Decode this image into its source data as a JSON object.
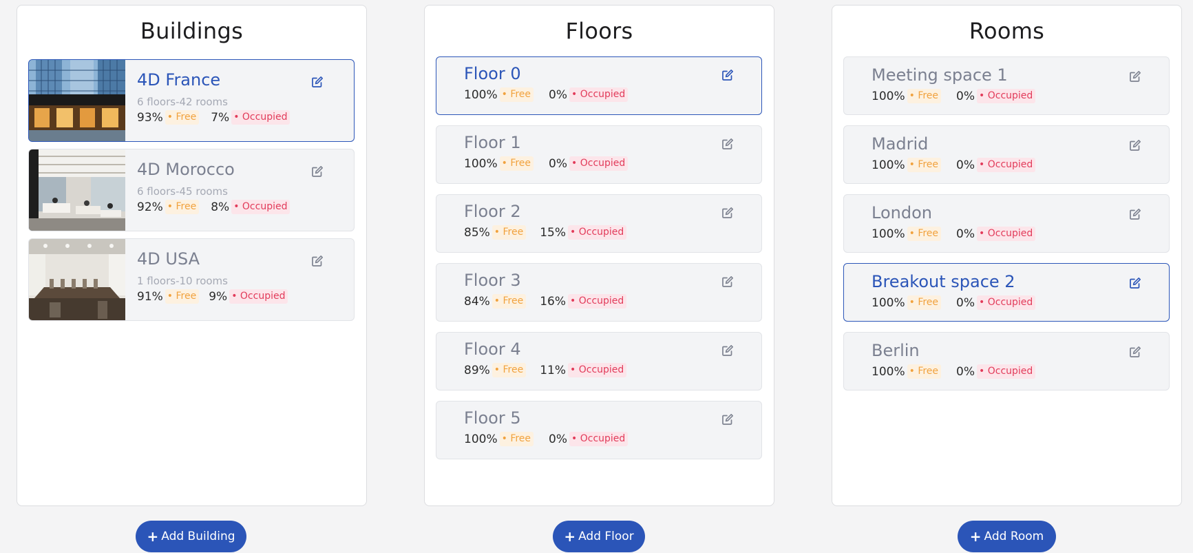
{
  "buildings": {
    "title": "Buildings",
    "items": [
      {
        "name": "4D France",
        "sub": "6 floors-42 rooms",
        "free": "93%",
        "occupied": "7%"
      },
      {
        "name": "4D Morocco",
        "sub": "6 floors-45 rooms",
        "free": "92%",
        "occupied": "8%"
      },
      {
        "name": "4D USA",
        "sub": "1 floors-10 rooms",
        "free": "91%",
        "occupied": "9%"
      }
    ],
    "add_label": "Add Building"
  },
  "floors": {
    "title": "Floors",
    "items": [
      {
        "name": "Floor 0",
        "free": "100%",
        "occupied": "0%"
      },
      {
        "name": "Floor 1",
        "free": "100%",
        "occupied": "0%"
      },
      {
        "name": "Floor 2",
        "free": "85%",
        "occupied": "15%"
      },
      {
        "name": "Floor 3",
        "free": "84%",
        "occupied": "16%"
      },
      {
        "name": "Floor 4",
        "free": "89%",
        "occupied": "11%"
      },
      {
        "name": "Floor 5",
        "free": "100%",
        "occupied": "0%"
      }
    ],
    "add_label": "Add Floor"
  },
  "rooms": {
    "title": "Rooms",
    "items": [
      {
        "name": "Meeting space 1",
        "free": "100%",
        "occupied": "0%"
      },
      {
        "name": "Madrid",
        "free": "100%",
        "occupied": "0%"
      },
      {
        "name": "London",
        "free": "100%",
        "occupied": "0%"
      },
      {
        "name": "Breakout space 2",
        "free": "100%",
        "occupied": "0%"
      },
      {
        "name": "Berlin",
        "free": "100%",
        "occupied": "0%"
      }
    ],
    "add_label": "Add Room"
  },
  "labels": {
    "free": "• Free",
    "occupied": "• Occupied"
  },
  "icons": {
    "edit": "edit-icon",
    "plus": "plus-icon"
  },
  "colors": {
    "accent": "#2b55b8",
    "free_text": "#f1a23e",
    "free_bg": "#fdf1e0",
    "occupied_text": "#e23b5a",
    "occupied_bg": "#fce5ea",
    "card_bg": "#f3f4f6",
    "page_bg": "#f4f4f5"
  }
}
